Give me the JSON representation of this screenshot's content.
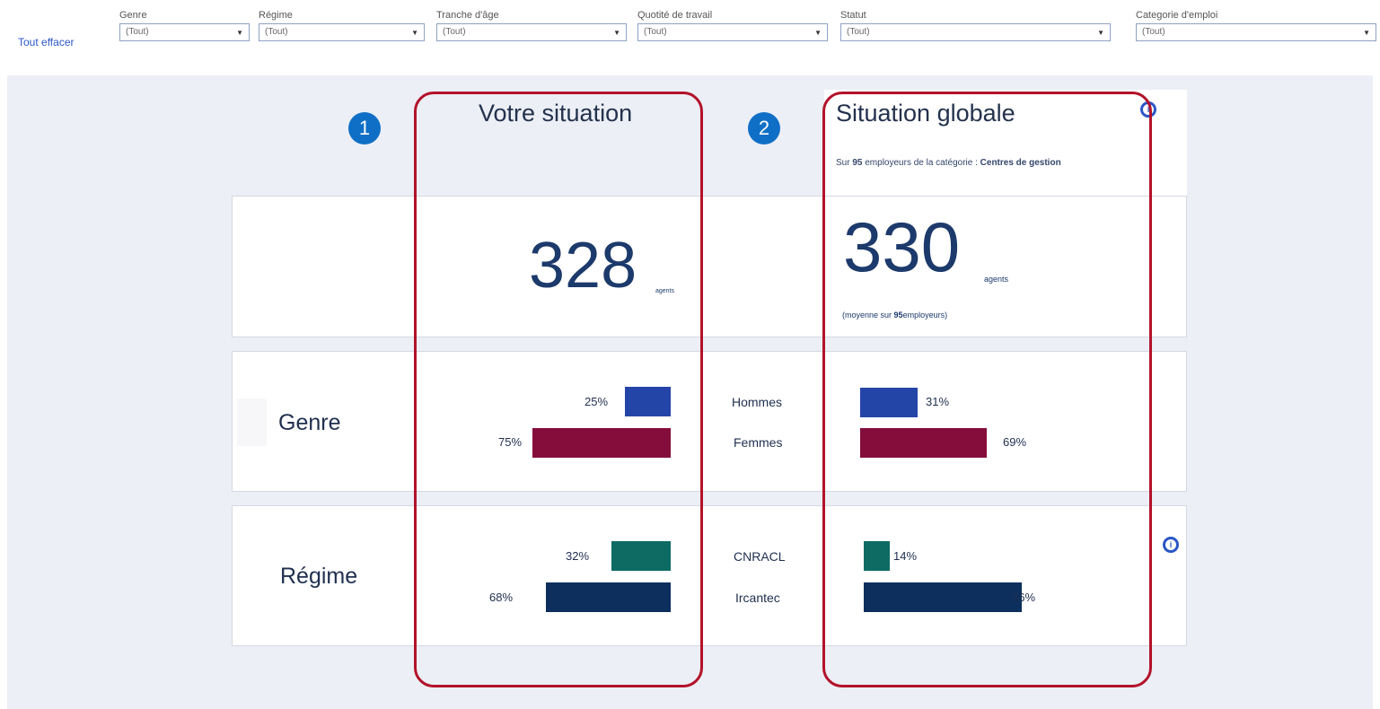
{
  "filters": {
    "clear_label": "Tout effacer",
    "items": [
      {
        "label": "Genre",
        "value": "(Tout)"
      },
      {
        "label": "Régime",
        "value": "(Tout)"
      },
      {
        "label": "Tranche d'âge",
        "value": "(Tout)"
      },
      {
        "label": "Quotité de travail",
        "value": "(Tout)"
      },
      {
        "label": "Statut",
        "value": "(Tout)"
      },
      {
        "label": "Categorie d'emploi",
        "value": "(Tout)"
      }
    ],
    "caret_icon": "chevron-down-icon"
  },
  "columns": {
    "yours": {
      "title": "Votre situation",
      "badge": "1"
    },
    "global": {
      "title": "Situation globale",
      "badge": "2",
      "subtitle_prefix": "Sur",
      "subtitle_count": "95",
      "subtitle_middle": "employeurs de la catégorie :",
      "subtitle_category": "Centres de gestion"
    }
  },
  "agents": {
    "yours": {
      "value": "328",
      "unit": "agents"
    },
    "global": {
      "value": "330",
      "unit": "agents",
      "note_prefix": "(moyenne sur",
      "note_count": "95",
      "note_suffix": "employeurs)"
    }
  },
  "genre": {
    "title": "Genre",
    "rows": [
      {
        "label": "Hommes",
        "yours_pct": "25%",
        "yours_value": 25,
        "global_pct": "31%",
        "global_value": 31,
        "color": "#2445a8"
      },
      {
        "label": "Femmes",
        "yours_pct": "75%",
        "yours_value": 75,
        "global_pct": "69%",
        "global_value": 69,
        "color": "#850d3c"
      }
    ]
  },
  "regime": {
    "title": "Régime",
    "rows": [
      {
        "label": "CNRACL",
        "yours_pct": "32%",
        "yours_value": 32,
        "global_pct": "14%",
        "global_value": 14,
        "color": "#0d6b64"
      },
      {
        "label": "Ircantec",
        "yours_pct": "68%",
        "yours_value": 68,
        "global_pct": "86%",
        "global_value": 86,
        "color": "#0c2f5e"
      }
    ]
  },
  "icons": {
    "info": "info-icon"
  },
  "colors": {
    "accent": "#2a56c6",
    "annotation": "#b3122a",
    "badge": "#0f6fc6"
  }
}
